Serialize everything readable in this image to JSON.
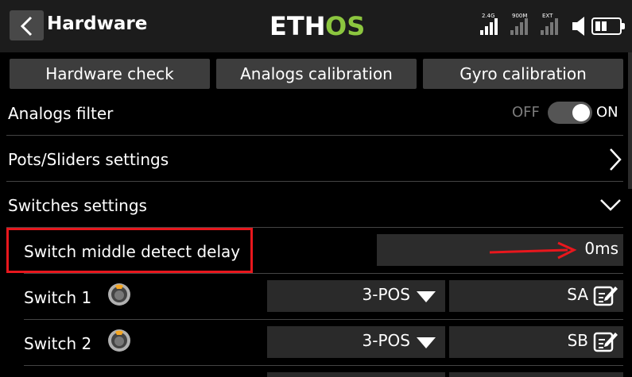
{
  "header": {
    "title": "Hardware",
    "logo_text": "ETH",
    "logo_accent": "OS",
    "accent_color": "#8cc63f",
    "signals": [
      {
        "label": "2.4G",
        "bars_on": 4
      },
      {
        "label": "900M",
        "bars_on": 0
      },
      {
        "label": "EXT",
        "bars_on": 0
      }
    ]
  },
  "actions": {
    "hardware_check": "Hardware check",
    "analogs_calibration": "Analogs calibration",
    "gyro_calibration": "Gyro calibration"
  },
  "analogs_filter": {
    "label": "Analogs filter",
    "off_label": "OFF",
    "on_label": "ON",
    "state": "on"
  },
  "pots_sliders": {
    "label": "Pots/Sliders settings"
  },
  "switches_settings": {
    "label": "Switches settings"
  },
  "middle_detect": {
    "label": "Switch middle detect delay",
    "value": "0ms",
    "highlight_color": "#e8171d"
  },
  "switches": [
    {
      "label": "Switch 1",
      "type": "3-POS",
      "source": "SA"
    },
    {
      "label": "Switch 2",
      "type": "3-POS",
      "source": "SB"
    }
  ]
}
